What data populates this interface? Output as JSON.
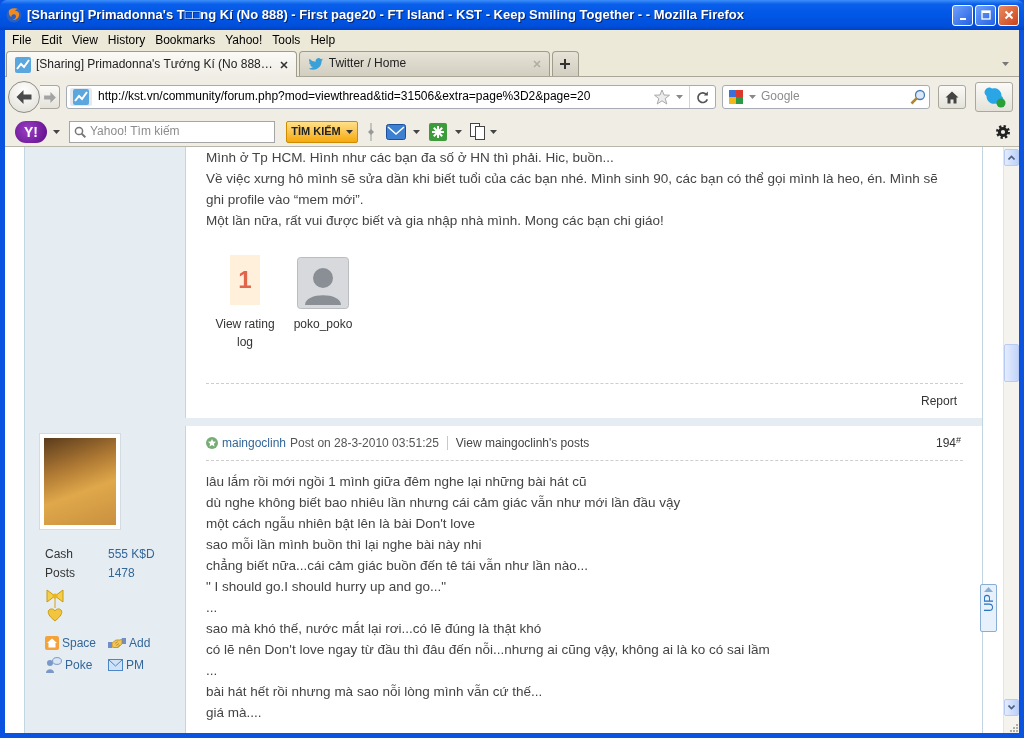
{
  "window": {
    "title": "[Sharing] Primadonna's T□□ng Kí (No 888) - First page20 - FT Island - KST - Keep Smiling Together - - Mozilla Firefox"
  },
  "menu": [
    "File",
    "Edit",
    "View",
    "History",
    "Bookmarks",
    "Yahoo!",
    "Tools",
    "Help"
  ],
  "tabs": [
    {
      "kind": "forum",
      "label": "[Sharing] Primadonna's Tướng Kí (No 888…",
      "selected": true
    },
    {
      "kind": "social",
      "label": "Twitter / Home",
      "selected": false
    }
  ],
  "address_bar": {
    "url": "http://kst.vn/community/forum.php?mod=viewthread&tid=31506&extra=page%3D2&page=20"
  },
  "search_bar": {
    "placeholder": "Google"
  },
  "yahoo_toolbar": {
    "logo": "Y!",
    "search": {
      "placeholder": "Yahoo! Tìm kiếm"
    },
    "search_button": "TÌM KIẾM"
  },
  "posts": [
    {
      "message": [
        "Mình ở Tp HCM. Hình như các bạn đa số ở HN thì phải. Hic, buồn...",
        "Về việc xưng hô mình sẽ sửa dần khi biết tuổi của các bạn nhé. Mình sinh 90, các bạn có thể gọi mình là heo, én. Mình sẽ ghi profile vào “mem mới”.",
        "Một lần nữa, rất vui được biết và gia nhập nhà mình. Mong các bạn chi giáo!"
      ],
      "rating": {
        "score": "1",
        "link": "View rating log"
      },
      "raters": [
        {
          "name": "poko_poko"
        }
      ],
      "report": "Report"
    },
    {
      "author": "maingoclinh",
      "posted": "Post on 28-3-2010 03:51:25",
      "view_posts": "View maingoclinh's posts",
      "floor": "194$^{#}$",
      "stats": [
        {
          "label": "Cash",
          "value": "555 K$D"
        },
        {
          "label": "Posts",
          "value": "1478"
        }
      ],
      "actions": [
        {
          "kind": "space",
          "label": "Space"
        },
        {
          "kind": "add",
          "label": "Add"
        },
        {
          "kind": "poke",
          "label": "Poke"
        },
        {
          "kind": "pm",
          "label": "PM"
        }
      ],
      "message": [
        "lâu lắm rồi mới ngồi 1 mình giữa đêm nghe lại những bài hát cũ",
        "dù nghe không biết bao nhiêu lần nhưng cái cảm giác vẫn như mới lần đầu vậy",
        "một cách ngẫu nhiên bật lên là bài Don't love",
        "sao mỗi lần mình buồn thì lại nghe bài này nhi",
        "chẳng biết nữa...cái cảm giác buồn đến tê tái vẫn như lần nào...",
        "\" I should go.I should hurry up and go...\"",
        "...",
        "sao mà khó thế, nước mắt lại rơi...có lẽ đúng là thật khó",
        "có lẽ nên Don't love ngay từ đầu thì đâu đến nỗi...nhưng ai cũng vậy, không ai là ko có sai lầm",
        "...",
        "bài hát hết rồi nhưng mà sao nỗi lòng mình vẫn cứ thế...",
        "giá mà...."
      ]
    }
  ],
  "up_button": "UP"
}
